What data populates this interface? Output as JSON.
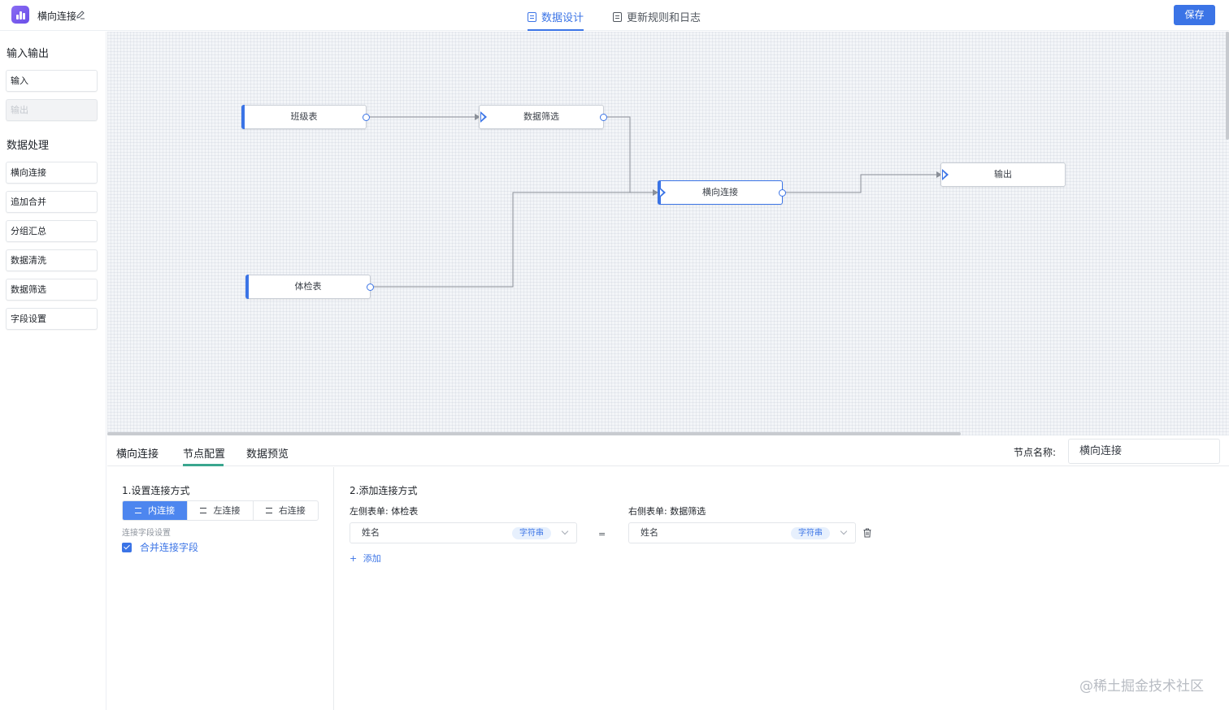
{
  "header": {
    "app_title": "横向连接",
    "tabs": [
      {
        "label": "数据设计",
        "active": true
      },
      {
        "label": "更新规则和日志",
        "active": false
      }
    ],
    "save_label": "保存"
  },
  "sidebar": {
    "section1_title": "输入输出",
    "io_items": [
      {
        "label": "输入",
        "disabled": false
      },
      {
        "label": "输出",
        "disabled": true
      }
    ],
    "section2_title": "数据处理",
    "process_items": [
      "横向连接",
      "追加合并",
      "分组汇总",
      "数据清洗",
      "数据筛选",
      "字段设置"
    ]
  },
  "canvas": {
    "nodes": {
      "class_table": "班级表",
      "filter": "数据筛选",
      "join": "横向连接",
      "output": "输出",
      "health": "体检表"
    }
  },
  "bottom": {
    "tabs": [
      "横向连接",
      "节点配置",
      "数据预览"
    ],
    "active_tab": "节点配置",
    "node_name_label": "节点名称:",
    "node_name_value": "横向连接",
    "join_section_title": "1.设置连接方式",
    "join_modes": [
      {
        "label": "内连接",
        "active": true
      },
      {
        "label": "左连接",
        "active": false
      },
      {
        "label": "右连接",
        "active": false
      }
    ],
    "join_field_settings": "连接字段设置",
    "merge_fields_label": "合并连接字段",
    "merge_fields_checked": true,
    "add_section_title": "2.添加连接方式",
    "left_table_label": "左侧表单: 体检表",
    "right_table_label": "右侧表单: 数据筛选",
    "left_field": "姓名",
    "left_field_type": "字符串",
    "equals": "=",
    "right_field": "姓名",
    "right_field_type": "字符串",
    "add_label": "添加"
  },
  "watermark": "@稀土掘金技术社区",
  "colors": {
    "primary": "#3b74e6",
    "accent_green": "#3aa68f"
  }
}
